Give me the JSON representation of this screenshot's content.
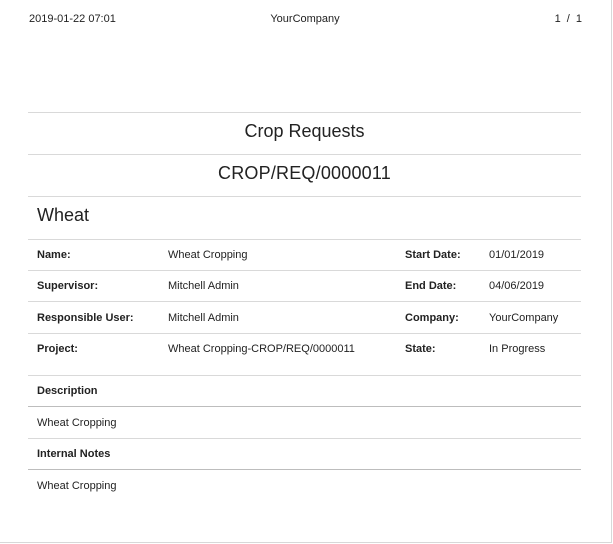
{
  "header": {
    "datetime": "2019-01-22 07:01",
    "company": "YourCompany",
    "pager": "1 / 1"
  },
  "report": {
    "title": "Crop Requests",
    "reference": "CROP/REQ/0000011",
    "crop": "Wheat"
  },
  "fields": {
    "name_label": "Name:",
    "name_value": "Wheat Cropping",
    "start_date_label": "Start Date:",
    "start_date_value": "01/01/2019",
    "supervisor_label": "Supervisor:",
    "supervisor_value": "Mitchell Admin",
    "end_date_label": "End Date:",
    "end_date_value": "04/06/2019",
    "responsible_label": "Responsible User:",
    "responsible_value": "Mitchell Admin",
    "company_label": "Company:",
    "company_value": "YourCompany",
    "project_label": "Project:",
    "project_value": "Wheat Cropping-CROP/REQ/0000011",
    "state_label": "State:",
    "state_value": "In Progress"
  },
  "description": {
    "label": "Description",
    "value": "Wheat Cropping"
  },
  "internal_notes": {
    "label": "Internal Notes",
    "value": "Wheat Cropping"
  }
}
